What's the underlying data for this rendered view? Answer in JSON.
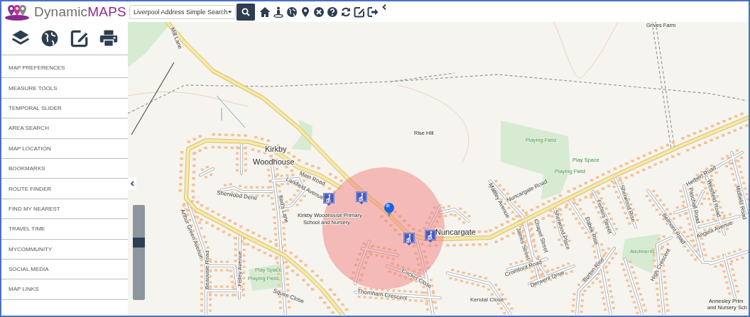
{
  "header": {
    "logo": {
      "text": "Dynamic",
      "accent": "MAPS"
    },
    "search": {
      "value": "Liverpool Address Simple Search"
    }
  },
  "sidebar": {
    "items": [
      {
        "label": "MAP PREFERENCES"
      },
      {
        "label": "MEASURE TOOLS"
      },
      {
        "label": "TEMPORAL SLIDER"
      },
      {
        "label": "AREA SEARCH"
      },
      {
        "label": "MAP LOCATION"
      },
      {
        "label": "BOOKMARKS"
      },
      {
        "label": "ROUTE FINDER"
      },
      {
        "label": "FIND MY NEAREST"
      },
      {
        "label": "TRAVEL TIME"
      },
      {
        "label": "MYCOMMUNITY"
      },
      {
        "label": "SOCIAL MEDIA"
      },
      {
        "label": "MAP LINKS"
      }
    ]
  },
  "map": {
    "zoom_slider": {
      "level": 0.62
    },
    "labels": [
      {
        "text": "Grives Farm",
        "kind": "place"
      },
      {
        "text": "Mill Lane",
        "kind": "road"
      },
      {
        "text": "Rise Hill",
        "kind": "place"
      },
      {
        "text": "Playing Field",
        "kind": "area"
      },
      {
        "text": "Play Space",
        "kind": "area"
      },
      {
        "text": "Playing Field",
        "kind": "area"
      },
      {
        "text": "Kirkby",
        "kind": "town"
      },
      {
        "text": "Woodhouse",
        "kind": "town"
      },
      {
        "text": "Main Road",
        "kind": "road"
      },
      {
        "text": "Kirkby Woodhouse Primary",
        "kind": "place"
      },
      {
        "text": "School and Nursery",
        "kind": "place"
      },
      {
        "text": "Nuncargate",
        "kind": "town"
      },
      {
        "text": "Nuncargate Road",
        "kind": "road"
      },
      {
        "text": "Sherwood Dene",
        "kind": "road"
      },
      {
        "text": "Larkfield Avenue",
        "kind": "road"
      },
      {
        "text": "Bird's Lane",
        "kind": "road"
      },
      {
        "text": "Arthur Green Avenue",
        "kind": "road"
      },
      {
        "text": "Beauvale Road",
        "kind": "road"
      },
      {
        "text": "Felley Avenue",
        "kind": "road"
      },
      {
        "text": "Play Space",
        "kind": "area"
      },
      {
        "text": "Playing Field",
        "kind": "area"
      },
      {
        "text": "Squire Close",
        "kind": "road"
      },
      {
        "text": "Thornham Crescent",
        "kind": "road"
      },
      {
        "text": "Cricket Close",
        "kind": "road"
      },
      {
        "text": "Mattley Avenue",
        "kind": "road"
      },
      {
        "text": "James Street",
        "kind": "road"
      },
      {
        "text": "Chapel Street",
        "kind": "road"
      },
      {
        "text": "Sherwood Place",
        "kind": "road"
      },
      {
        "text": "Cromford Road",
        "kind": "road"
      },
      {
        "text": "Derwent Drive",
        "kind": "road"
      },
      {
        "text": "Dabek Rise",
        "kind": "road"
      },
      {
        "text": "Fishers Street",
        "kind": "road"
      },
      {
        "text": "Sherwood Rise",
        "kind": "road"
      },
      {
        "text": "Burton Rise",
        "kind": "road"
      },
      {
        "text": "Allotments",
        "kind": "area"
      },
      {
        "text": "High Crescent",
        "kind": "road"
      },
      {
        "text": "Belmont Road",
        "kind": "road"
      },
      {
        "text": "Herbert Road",
        "kind": "road"
      },
      {
        "text": "Paschall Road",
        "kind": "road"
      },
      {
        "text": "Westfield Road",
        "kind": "road"
      },
      {
        "text": "Midfield Road",
        "kind": "road"
      },
      {
        "text": "Angela Avenue",
        "kind": "road"
      },
      {
        "text": "Kendal Close",
        "kind": "road"
      },
      {
        "text": "Annesley Prim",
        "kind": "place"
      },
      {
        "text": "and Nursery Sch",
        "kind": "place"
      }
    ]
  }
}
